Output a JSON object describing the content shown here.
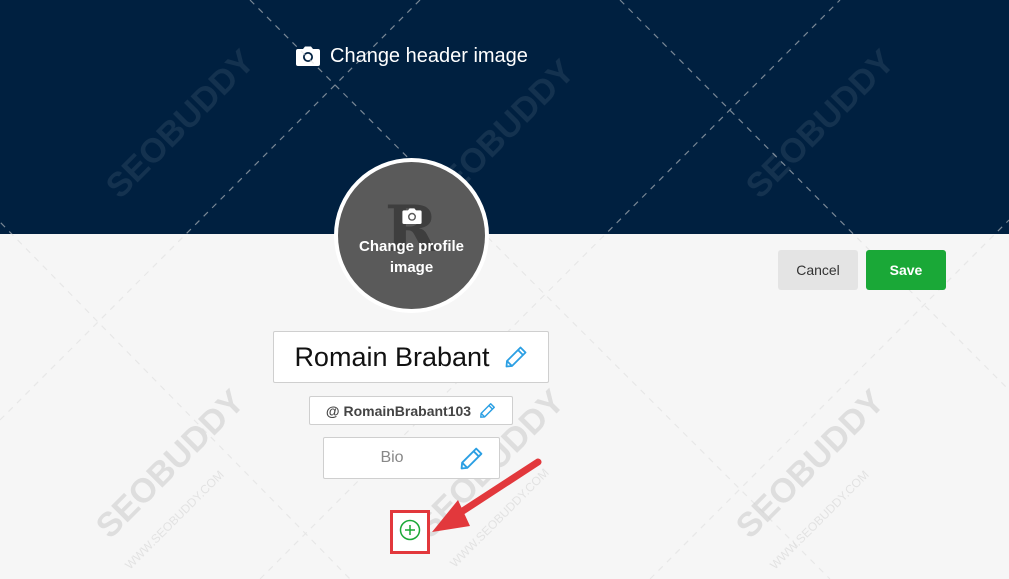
{
  "header": {
    "change_header_label": "Change header image",
    "background_color": "#002040",
    "icon": "camera-icon"
  },
  "profile": {
    "avatar_initial": "R",
    "change_profile_label": "Change profile image",
    "avatar_icon": "camera-icon",
    "display_name": "Romain Brabant",
    "handle": "@ RomainBrabant103",
    "bio_placeholder": "Bio"
  },
  "actions": {
    "cancel_label": "Cancel",
    "save_label": "Save",
    "save_color": "#1aa837"
  },
  "add_field": {
    "icon": "plus-circle-icon",
    "highlight_color": "#e2383c"
  },
  "watermark": {
    "brand": "SEOBUDDY",
    "url": "WWW.SEOBUDDY.COM"
  },
  "colors": {
    "accent": "#2b9fe3",
    "plus": "#1aa837"
  }
}
